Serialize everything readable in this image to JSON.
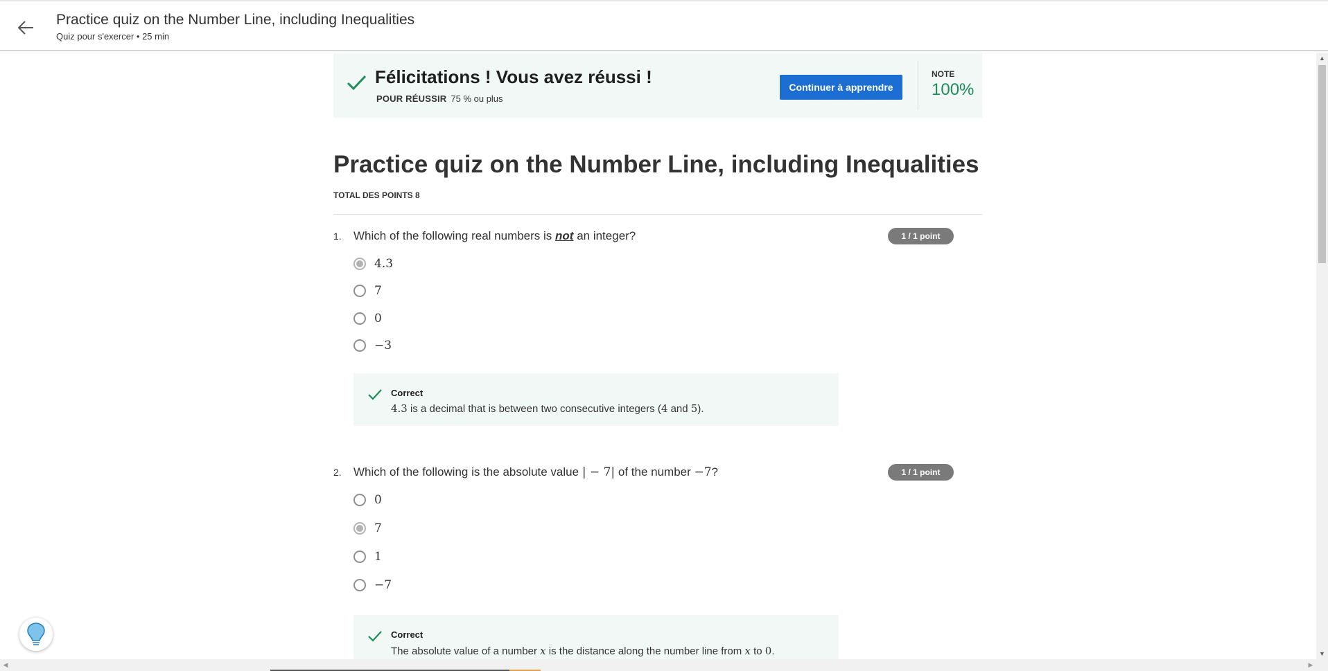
{
  "header": {
    "title": "Practice quiz on the Number Line, including Inequalities",
    "subtitle": "Quiz pour s'exercer • 25  min"
  },
  "banner": {
    "title": "Félicitations ! Vous avez réussi !",
    "pass_label": "POUR RÉUSSIR",
    "pass_value": "75 % ou plus",
    "continue_label": "Continuer à apprendre",
    "grade_label": "NOTE",
    "grade_value": "100%"
  },
  "quiz": {
    "title": "Practice quiz on the Number Line, including Inequalities",
    "total_points_label": "TOTAL DES POINTS",
    "total_points_value": "8"
  },
  "questions": [
    {
      "number": "1.",
      "text_before": "Which of the following real numbers is ",
      "text_emphasis": "not",
      "text_after": " an integer?",
      "score": "1 / 1 point",
      "options": [
        "4.3",
        "7",
        "0",
        "−3"
      ],
      "selected_index": 0,
      "feedback": {
        "title": "Correct",
        "text_parts": [
          "4.3",
          " is a decimal that is between two consecutive integers (",
          "4",
          " and ",
          "5",
          ")."
        ]
      }
    },
    {
      "number": "2.",
      "text_before": "Which of the following is the absolute value ",
      "text_math1": "| − 7|",
      "text_middle": " of the number ",
      "text_math2": "−7",
      "text_after": "?",
      "score": "1 / 1 point",
      "options": [
        "0",
        "7",
        "1",
        "−7"
      ],
      "selected_index": 1,
      "feedback": {
        "title": "Correct",
        "text_parts": [
          "The absolute value of a number ",
          "x",
          " is the distance along the number line from ",
          "x",
          " to ",
          "0",
          "."
        ]
      }
    }
  ],
  "colors": {
    "accent": "#1c6ed2",
    "success": "#1e8c5b",
    "banner_bg": "#f2f8f5"
  },
  "icons": [
    "back-arrow-icon",
    "check-icon",
    "lightbulb-icon"
  ]
}
